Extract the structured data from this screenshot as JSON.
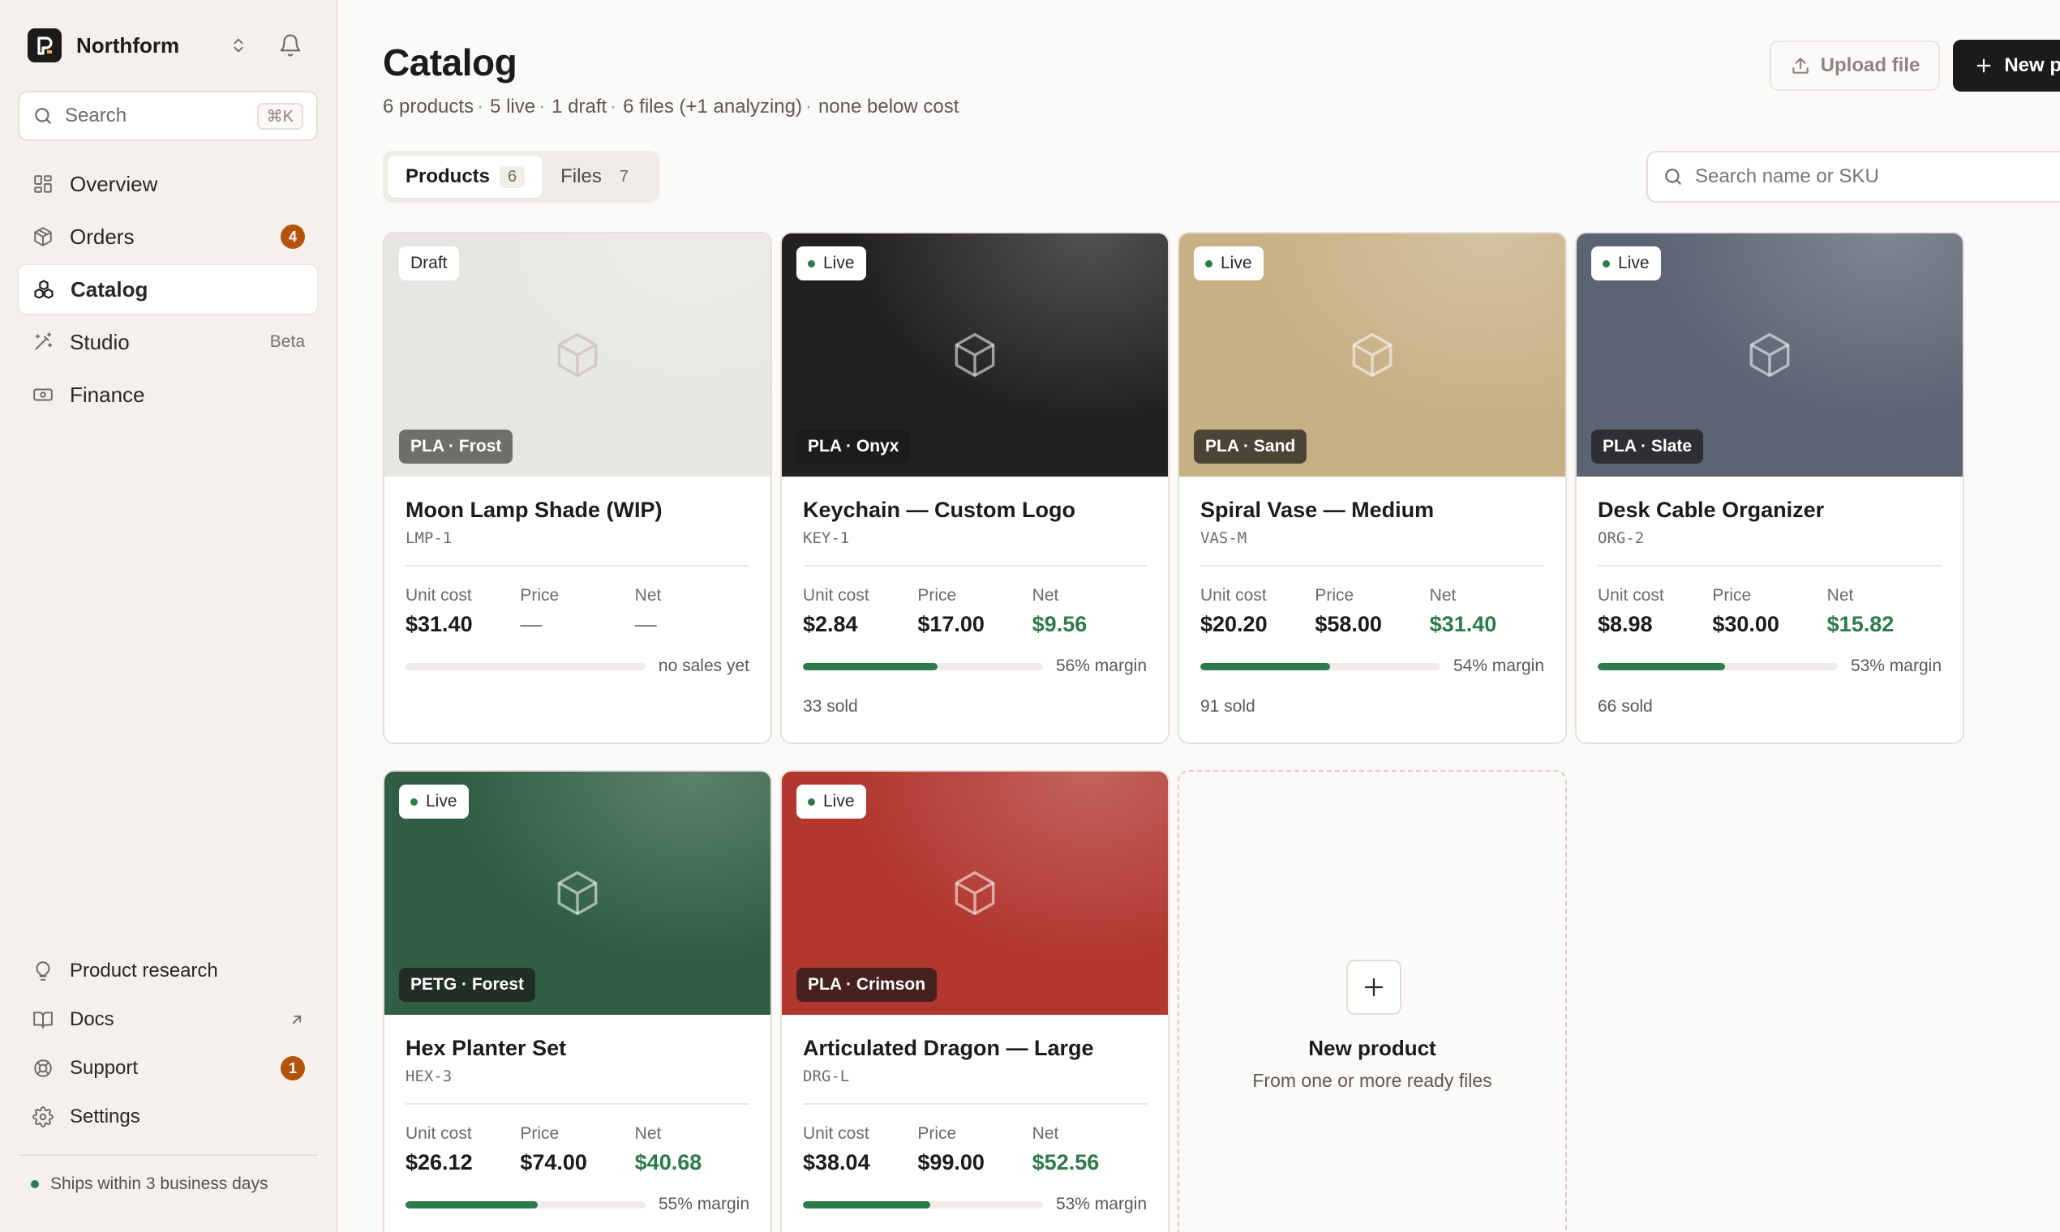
{
  "brand": {
    "name": "Northform"
  },
  "search": {
    "label": "Search",
    "shortcut": "⌘K"
  },
  "nav": [
    {
      "label": "Overview",
      "icon": "grid-icon"
    },
    {
      "label": "Orders",
      "icon": "package-icon",
      "badge": "4"
    },
    {
      "label": "Catalog",
      "icon": "catalog-icon",
      "active": true
    },
    {
      "label": "Studio",
      "icon": "magic-wand-icon",
      "tag": "Beta"
    },
    {
      "label": "Finance",
      "icon": "banknote-icon"
    }
  ],
  "bottom_nav": [
    {
      "label": "Product research",
      "icon": "lightbulb-icon"
    },
    {
      "label": "Docs",
      "icon": "book-icon"
    },
    {
      "label": "Support",
      "icon": "lifebuoy-icon",
      "badge": "1"
    },
    {
      "label": "Settings",
      "icon": "gear-icon"
    }
  ],
  "ship_note": "Ships within 3 business days",
  "header": {
    "title": "Catalog",
    "summary": [
      "6 products",
      "5 live",
      "1 draft",
      "6 files (+1 analyzing)",
      "none below cost"
    ],
    "upload_label": "Upload file",
    "new_label": "New product"
  },
  "tabs": [
    {
      "label": "Products",
      "count": "6",
      "active": true
    },
    {
      "label": "Files",
      "count": "7",
      "active": false
    }
  ],
  "product_search": {
    "placeholder": "Search name or SKU"
  },
  "colors": {
    "accent_green": "#2f7a4b",
    "badge_orange": "#b45309"
  },
  "products": [
    {
      "status": "Draft",
      "material": "PLA · Frost",
      "name": "Moon Lamp Shade (WIP)",
      "sku": "LMP-1",
      "unit_cost_label": "Unit cost",
      "unit_cost": "$31.40",
      "price_label": "Price",
      "price": "—",
      "net_label": "Net",
      "net": "—",
      "margin_pct": 0,
      "margin_text": "no sales yet",
      "sold": "",
      "media_color": "#e8e6e1"
    },
    {
      "status": "Live",
      "material": "PLA · Onyx",
      "name": "Keychain — Custom Logo",
      "sku": "KEY-1",
      "unit_cost_label": "Unit cost",
      "unit_cost": "$2.84",
      "price_label": "Price",
      "price": "$17.00",
      "net_label": "Net",
      "net": "$9.56",
      "margin_pct": 56,
      "margin_text": "56% margin",
      "sold": "33 sold",
      "media_color": "#22211f"
    },
    {
      "status": "Live",
      "material": "PLA · Sand",
      "name": "Spiral Vase — Medium",
      "sku": "VAS-M",
      "unit_cost_label": "Unit cost",
      "unit_cost": "$20.20",
      "price_label": "Price",
      "price": "$58.00",
      "net_label": "Net",
      "net": "$31.40",
      "margin_pct": 54,
      "margin_text": "54% margin",
      "sold": "91 sold",
      "media_color": "#c8b085"
    },
    {
      "status": "Live",
      "material": "PLA · Slate",
      "name": "Desk Cable Organizer",
      "sku": "ORG-2",
      "unit_cost_label": "Unit cost",
      "unit_cost": "$8.98",
      "price_label": "Price",
      "price": "$30.00",
      "net_label": "Net",
      "net": "$15.82",
      "margin_pct": 53,
      "margin_text": "53% margin",
      "sold": "66 sold",
      "media_color": "#5b6473"
    },
    {
      "status": "Live",
      "material": "PETG · Forest",
      "name": "Hex Planter Set",
      "sku": "HEX-3",
      "unit_cost_label": "Unit cost",
      "unit_cost": "$26.12",
      "price_label": "Price",
      "price": "$74.00",
      "net_label": "Net",
      "net": "$40.68",
      "margin_pct": 55,
      "margin_text": "55% margin",
      "sold": "",
      "media_color": "#2f5e44"
    },
    {
      "status": "Live",
      "material": "PLA · Crimson",
      "name": "Articulated Dragon — Large",
      "sku": "DRG-L",
      "unit_cost_label": "Unit cost",
      "unit_cost": "$38.04",
      "price_label": "Price",
      "price": "$99.00",
      "net_label": "Net",
      "net": "$52.56",
      "margin_pct": 53,
      "margin_text": "53% margin",
      "sold": "",
      "media_color": "#b2372f"
    }
  ],
  "new_product_card": {
    "title": "New product",
    "subtitle": "From one or more ready files"
  }
}
